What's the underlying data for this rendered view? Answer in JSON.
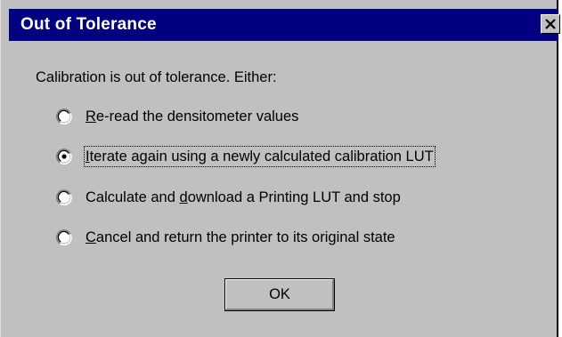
{
  "window": {
    "title": "Out of Tolerance"
  },
  "message": "Calibration is out of tolerance.  Either:",
  "options": [
    {
      "mnemonic": "R",
      "rest": "e-read the densitometer values",
      "selected": false
    },
    {
      "mnemonic": "I",
      "rest": "terate again using a newly calculated calibration LUT",
      "selected": true
    },
    {
      "before": "Calculate and ",
      "mnemonic": "d",
      "rest": "ownload a Printing LUT and stop",
      "selected": false
    },
    {
      "mnemonic": "C",
      "rest": "ancel and return the printer to its original state",
      "selected": false
    }
  ],
  "ok_button": {
    "label": "OK"
  },
  "colors": {
    "titlebar": "#000080",
    "dialog_face": "#c0c0c0"
  }
}
